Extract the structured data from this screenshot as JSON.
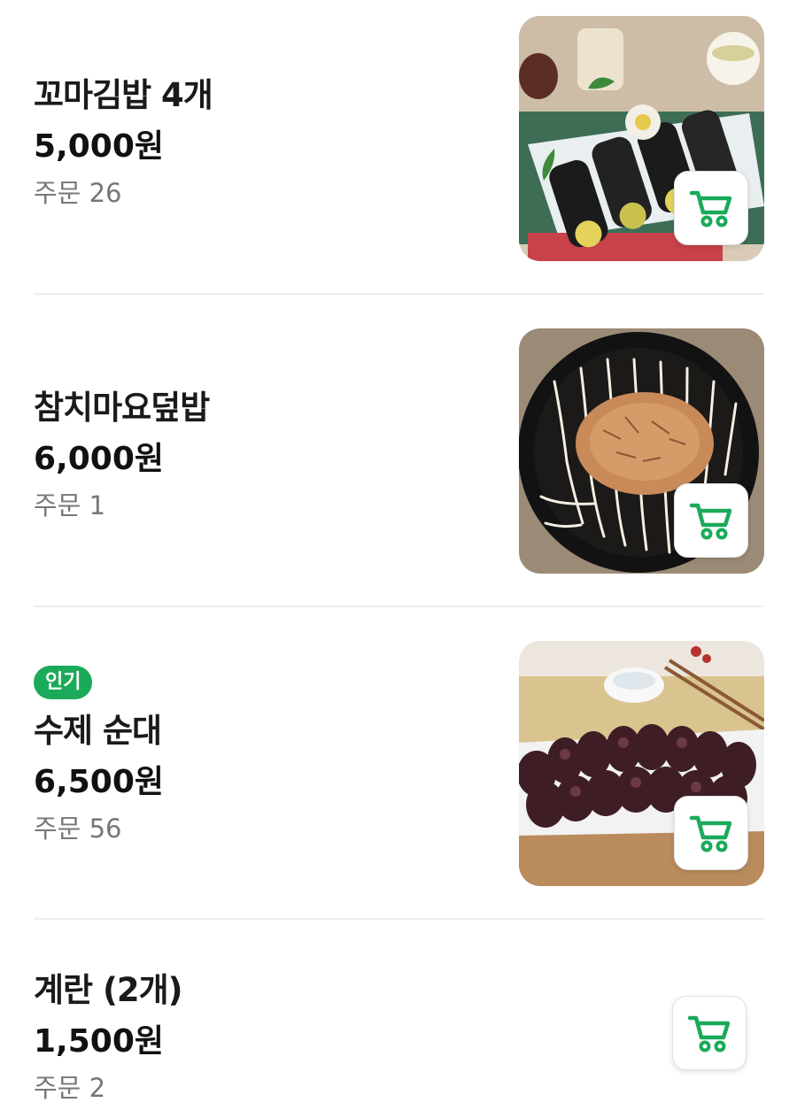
{
  "menu_items": [
    {
      "name": "꼬마김밥 4개",
      "price": "5,000원",
      "orders": "주문 26",
      "image": "kimbap-photo"
    },
    {
      "name": "참치마요덮밥",
      "price": "6,000원",
      "orders": "주문 1",
      "image": "tuna-mayo-rice-photo"
    },
    {
      "badge": "인기",
      "name": "수제 순대",
      "price": "6,500원",
      "orders": "주문 56",
      "image": "sundae-photo"
    },
    {
      "name": "계란 (2개)",
      "price": "1,500원",
      "orders": "주문 2"
    }
  ],
  "icons": {
    "cart": "cart-icon"
  },
  "colors": {
    "accent": "#1aaa5a",
    "badge_bg": "#1aaa5a",
    "divider": "#eeeeee",
    "muted_text": "#777777"
  }
}
